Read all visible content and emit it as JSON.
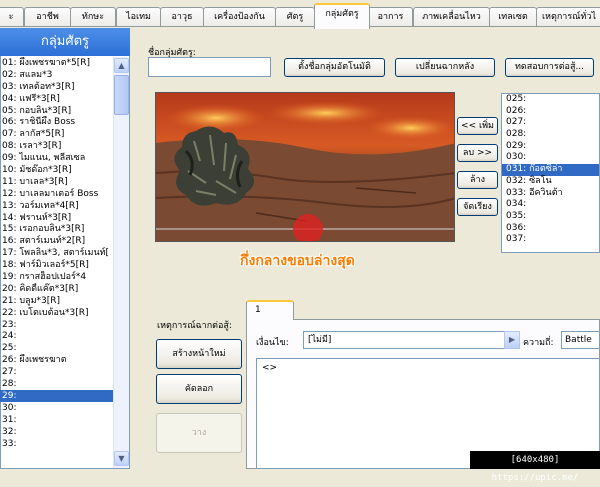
{
  "tabs": [
    {
      "label": "ะ"
    },
    {
      "label": "อาชีพ"
    },
    {
      "label": "ทักษะ"
    },
    {
      "label": "ไอเทม"
    },
    {
      "label": "อาวุธ"
    },
    {
      "label": "เครื่องป้องกัน"
    },
    {
      "label": "ศัตรู"
    },
    {
      "label": "กลุ่มศัตรู"
    },
    {
      "label": "อาการ"
    },
    {
      "label": "ภาพเคลื่อนไหว"
    },
    {
      "label": "เทลเซต"
    },
    {
      "label": "เหตุการณ์ทั่วไ"
    }
  ],
  "left": {
    "header": "กลุ่มศัตรู",
    "items": [
      "01: ผึ้งเพชรฆาต*5[R]",
      "02: สแลม*3",
      "03: เทลต้อท*3[R]",
      "04: แฟรี่*3[R]",
      "05: กอบลิน*3[R]",
      "06: ราชินีผึ้ง Boss",
      "07: ลากัส*5[R]",
      "08: เรลา*3[R]",
      "09: ไมแนน, พลีสเซล",
      "10: มัชด๊อก*3[R]",
      "11: บาเลล*3[R]",
      "12: บาเลลมาเตอร์ Boss",
      "13: วอร์มเทล*4[R]",
      "14: ฟรานห์*3[R]",
      "15: เรอกอบลิน*3[R]",
      "16: สตาร์เมนท์*2[R]",
      "17: โพลลิน*3, สตาร์เมนท์[",
      "18: ฟาร์มิวเลอร์*5[R]",
      "19: กราสฮ็อปเปอร์*4",
      "20: คิดดี้แค๊ต*3[R]",
      "21: บลูม*3[R]",
      "22: เบโตเบต้อน*3[R]",
      "23:",
      "24:",
      "25:",
      "26: ผึ้งเพชรฆาต",
      "27:",
      "28:",
      "29:",
      "30:",
      "31:",
      "32:",
      "33:"
    ]
  },
  "form": {
    "name_label": "ชื่อกลุ่มศัตรู:",
    "name_value": "",
    "auto_name_button": "ตั้งชื่อกลุ่มอัตโนมัติ",
    "change_bg_button": "เปลี่ยนฉากหลัง",
    "test_battle_button": "ทดสอบการต่อสู้...",
    "add_button": "<< เพิ่ม",
    "remove_button": "ลบ >>",
    "clear_button": "ล้าง",
    "arrange_button": "จัดเรียง"
  },
  "troops": [
    "025:",
    "026:",
    "027:",
    "028:",
    "029:",
    "030:",
    "031: ก๊อตซิล่า",
    "032: ซิลโน",
    "033: อีควินต้า",
    "034:",
    "035:",
    "036:",
    "037:"
  ],
  "annotation": "กึ่งกลางขอบล่างสุด",
  "events": {
    "section_label": "เหตุการณ์ฉากต่อสู้:",
    "page_tab": "1",
    "new_page_button": "สร้างหน้าใหม่",
    "copy_button": "คัดลอก",
    "paste_button": "วาง",
    "condition_label": "เงื่อนไข:",
    "condition_value": "[ไม่มี]",
    "span_label": "ความถี่:",
    "span_value": "Battle",
    "command_line": "<>"
  },
  "watermark": "[640x480] https://upic.me/",
  "colors": {
    "accent_blue": "#316ac5",
    "annotation_orange": "#ff7b00",
    "marker_red": "#e02020"
  }
}
